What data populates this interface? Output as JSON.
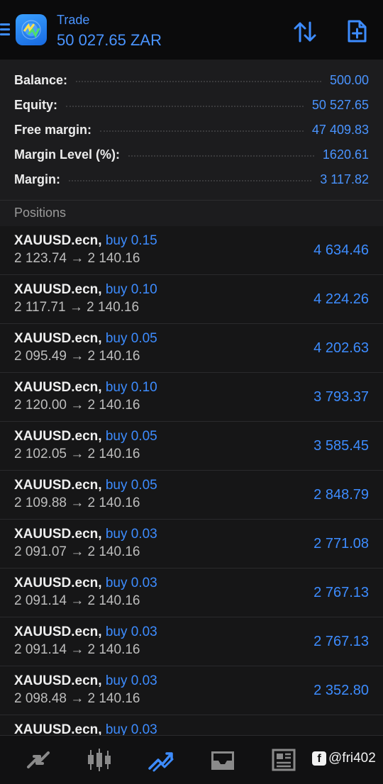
{
  "header": {
    "title": "Trade",
    "subtitle": "50 027.65 ZAR"
  },
  "summary": [
    {
      "label": "Balance:",
      "value": "500.00"
    },
    {
      "label": "Equity:",
      "value": "50 527.65"
    },
    {
      "label": "Free margin:",
      "value": "47 409.83"
    },
    {
      "label": "Margin Level (%):",
      "value": "1620.61"
    },
    {
      "label": "Margin:",
      "value": "3 117.82"
    }
  ],
  "positions_header": "Positions",
  "positions": [
    {
      "symbol": "XAUUSD.ecn,",
      "side": "buy 0.15",
      "prices": "2 123.74 → 2 140.16",
      "profit": "4 634.46"
    },
    {
      "symbol": "XAUUSD.ecn,",
      "side": "buy 0.10",
      "prices": "2 117.71 → 2 140.16",
      "profit": "4 224.26"
    },
    {
      "symbol": "XAUUSD.ecn,",
      "side": "buy 0.05",
      "prices": "2 095.49 → 2 140.16",
      "profit": "4 202.63"
    },
    {
      "symbol": "XAUUSD.ecn,",
      "side": "buy 0.10",
      "prices": "2 120.00 → 2 140.16",
      "profit": "3 793.37"
    },
    {
      "symbol": "XAUUSD.ecn,",
      "side": "buy 0.05",
      "prices": "2 102.05 → 2 140.16",
      "profit": "3 585.45"
    },
    {
      "symbol": "XAUUSD.ecn,",
      "side": "buy 0.05",
      "prices": "2 109.88 → 2 140.16",
      "profit": "2 848.79"
    },
    {
      "symbol": "XAUUSD.ecn,",
      "side": "buy 0.03",
      "prices": "2 091.07 → 2 140.16",
      "profit": "2 771.08"
    },
    {
      "symbol": "XAUUSD.ecn,",
      "side": "buy 0.03",
      "prices": "2 091.14 → 2 140.16",
      "profit": "2 767.13"
    },
    {
      "symbol": "XAUUSD.ecn,",
      "side": "buy 0.03",
      "prices": "2 091.14 → 2 140.16",
      "profit": "2 767.13"
    },
    {
      "symbol": "XAUUSD.ecn,",
      "side": "buy 0.03",
      "prices": "2 098.48 → 2 140.16",
      "profit": "2 352.80"
    },
    {
      "symbol": "XAUUSD.ecn,",
      "side": "buy 0.03",
      "prices": "",
      "profit": ""
    }
  ],
  "bottom_nav": [
    {
      "icon": "quotes-icon",
      "active": false
    },
    {
      "icon": "chart-icon",
      "active": false
    },
    {
      "icon": "trade-icon",
      "active": true
    },
    {
      "icon": "history-icon",
      "active": false
    },
    {
      "icon": "news-icon",
      "active": false
    }
  ],
  "watermark": {
    "icon": "facebook-icon",
    "text": "@fri402"
  },
  "colors": {
    "accent": "#3d8cff",
    "background": "#1c1c1e",
    "row": "#161617",
    "header": "#0b0b0c"
  }
}
